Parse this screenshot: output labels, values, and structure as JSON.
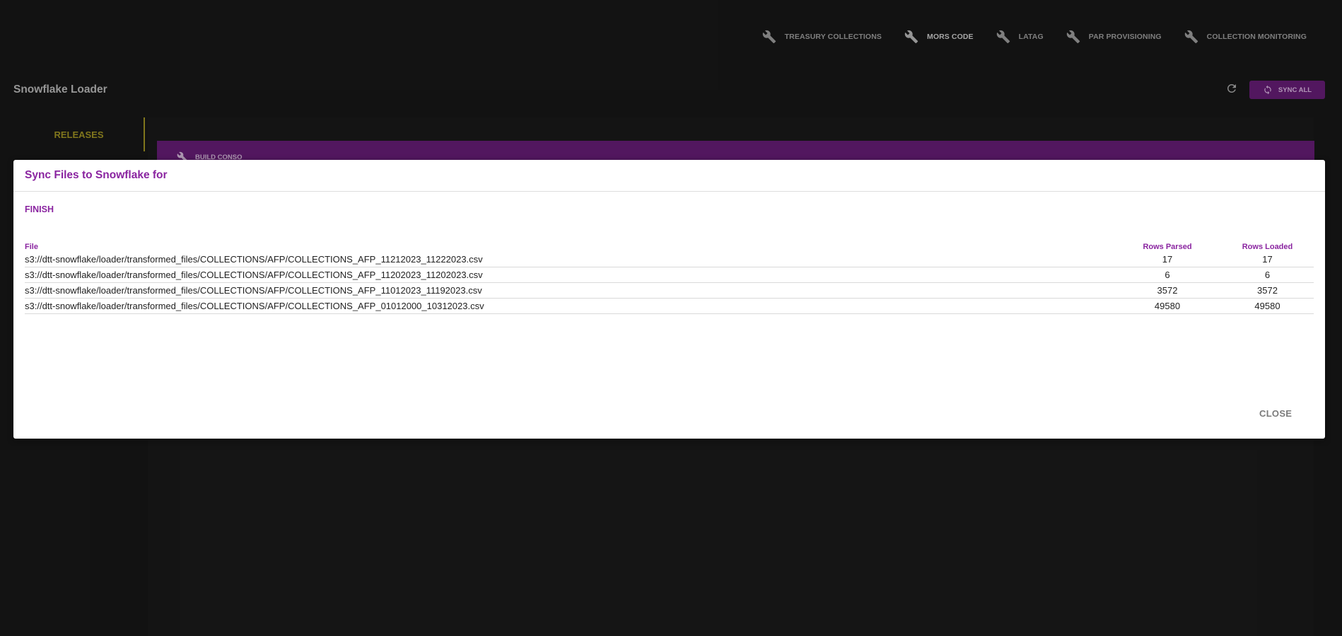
{
  "nav": {
    "items": [
      {
        "label": "TREASURY COLLECTIONS"
      },
      {
        "label": "MORS CODE"
      },
      {
        "label": "LATAG"
      },
      {
        "label": "PAR PROVISIONING"
      },
      {
        "label": "COLLECTION MONITORING"
      }
    ]
  },
  "header": {
    "title": "Snowflake Loader",
    "refresh_icon": "refresh-icon",
    "sync_all_label": "SYNC ALL"
  },
  "tabs": {
    "releases_label": "RELEASES"
  },
  "background": {
    "build_label": "BUILD CONSO"
  },
  "modal": {
    "title": "Sync Files to Snowflake for",
    "status": "FINISH",
    "columns": {
      "file": "File",
      "rows_parsed": "Rows Parsed",
      "rows_loaded": "Rows Loaded"
    },
    "rows": [
      {
        "file": "s3://dtt-snowflake/loader/transformed_files/COLLECTIONS/AFP/COLLECTIONS_AFP_11212023_11222023.csv",
        "parsed": "17",
        "loaded": "17"
      },
      {
        "file": "s3://dtt-snowflake/loader/transformed_files/COLLECTIONS/AFP/COLLECTIONS_AFP_11202023_11202023.csv",
        "parsed": "6",
        "loaded": "6"
      },
      {
        "file": "s3://dtt-snowflake/loader/transformed_files/COLLECTIONS/AFP/COLLECTIONS_AFP_11012023_11192023.csv",
        "parsed": "3572",
        "loaded": "3572"
      },
      {
        "file": "s3://dtt-snowflake/loader/transformed_files/COLLECTIONS/AFP/COLLECTIONS_AFP_01012000_10312023.csv",
        "parsed": "49580",
        "loaded": "49580"
      }
    ],
    "close_label": "CLOSE"
  },
  "colors": {
    "accent_purple": "#8a24a0",
    "bar_purple": "#5c1a6a",
    "tab_olive": "#8f8420",
    "background": "#151515"
  }
}
